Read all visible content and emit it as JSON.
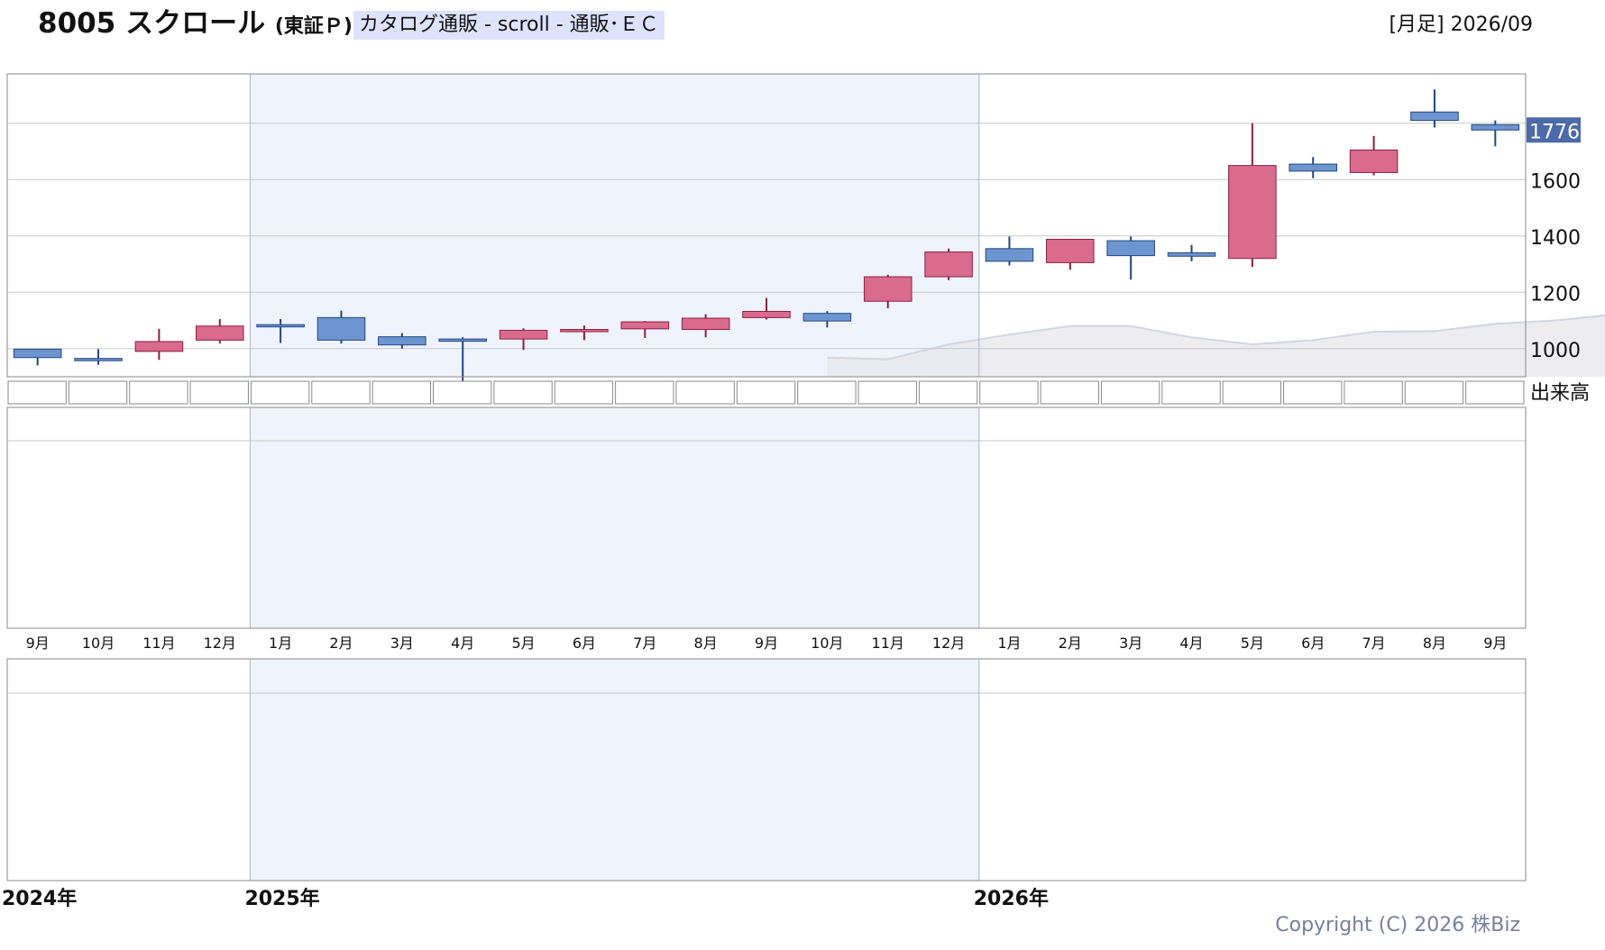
{
  "header": {
    "code_name": "8005 スクロール",
    "market": "(東証Ｐ)",
    "category": "カタログ通販 - scroll - 通販･ＥＣ",
    "period": "[月足] 2026/09"
  },
  "volume_label": "出来高",
  "copyright": "Copyright (C) 2026 株Biz",
  "colors": {
    "up_fill": "#d96b8f",
    "up_line": "#8b2140",
    "down_fill": "#6d95cf",
    "down_line": "#24467e",
    "year_band": "#eef3fd",
    "ma_fill": "#e9e9ee",
    "ma_line": "#d3d5e0",
    "price_tag_bg": "#4c6aa7"
  },
  "chart_data": {
    "type": "candlestick",
    "ylim": [
      900,
      1960
    ],
    "yticks": [
      1000,
      1200,
      1400,
      1600
    ],
    "last_price_label": "1776",
    "x_month_labels": [
      "9月",
      "10月",
      "11月",
      "12月",
      "1月",
      "2月",
      "3月",
      "4月",
      "5月",
      "6月",
      "7月",
      "8月",
      "9月",
      "10月",
      "11月",
      "12月",
      "1月",
      "2月",
      "3月",
      "4月",
      "5月",
      "6月",
      "7月",
      "8月",
      "9月"
    ],
    "year_labels": [
      {
        "label": "2024年",
        "index": 0
      },
      {
        "label": "2025年",
        "index": 4
      },
      {
        "label": "2026年",
        "index": 16
      }
    ],
    "highlight_year_range": [
      4,
      15
    ],
    "candles": [
      {
        "o": 998,
        "h": 998,
        "l": 940,
        "c": 968
      },
      {
        "o": 965,
        "h": 998,
        "l": 942,
        "c": 958
      },
      {
        "o": 990,
        "h": 1070,
        "l": 960,
        "c": 1025
      },
      {
        "o": 1030,
        "h": 1105,
        "l": 1018,
        "c": 1080
      },
      {
        "o": 1085,
        "h": 1105,
        "l": 1020,
        "c": 1080
      },
      {
        "o": 1110,
        "h": 1135,
        "l": 1018,
        "c": 1030
      },
      {
        "o": 1042,
        "h": 1055,
        "l": 1000,
        "c": 1013
      },
      {
        "o": 1034,
        "h": 1040,
        "l": 880,
        "c": 1030
      },
      {
        "o": 1034,
        "h": 1072,
        "l": 995,
        "c": 1065
      },
      {
        "o": 1062,
        "h": 1082,
        "l": 1030,
        "c": 1068
      },
      {
        "o": 1070,
        "h": 1098,
        "l": 1038,
        "c": 1095
      },
      {
        "o": 1068,
        "h": 1122,
        "l": 1040,
        "c": 1108
      },
      {
        "o": 1110,
        "h": 1180,
        "l": 1103,
        "c": 1132
      },
      {
        "o": 1125,
        "h": 1133,
        "l": 1075,
        "c": 1098
      },
      {
        "o": 1168,
        "h": 1262,
        "l": 1143,
        "c": 1255
      },
      {
        "o": 1255,
        "h": 1355,
        "l": 1243,
        "c": 1343
      },
      {
        "o": 1355,
        "h": 1398,
        "l": 1295,
        "c": 1310
      },
      {
        "o": 1305,
        "h": 1390,
        "l": 1280,
        "c": 1388
      },
      {
        "o": 1383,
        "h": 1398,
        "l": 1245,
        "c": 1330
      },
      {
        "o": 1340,
        "h": 1368,
        "l": 1310,
        "c": 1328
      },
      {
        "o": 1320,
        "h": 1800,
        "l": 1290,
        "c": 1650
      },
      {
        "o": 1655,
        "h": 1680,
        "l": 1605,
        "c": 1630
      },
      {
        "o": 1625,
        "h": 1755,
        "l": 1615,
        "c": 1705
      },
      {
        "o": 1840,
        "h": 1920,
        "l": 1785,
        "c": 1810
      },
      {
        "o": 1795,
        "h": 1810,
        "l": 1718,
        "c": 1776
      }
    ],
    "moving_average": {
      "start_index": 13,
      "values": [
        968,
        962,
        1015,
        1050,
        1080,
        1080,
        1040,
        1015,
        1030,
        1060,
        1062,
        1088,
        1100,
        1122
      ]
    }
  }
}
